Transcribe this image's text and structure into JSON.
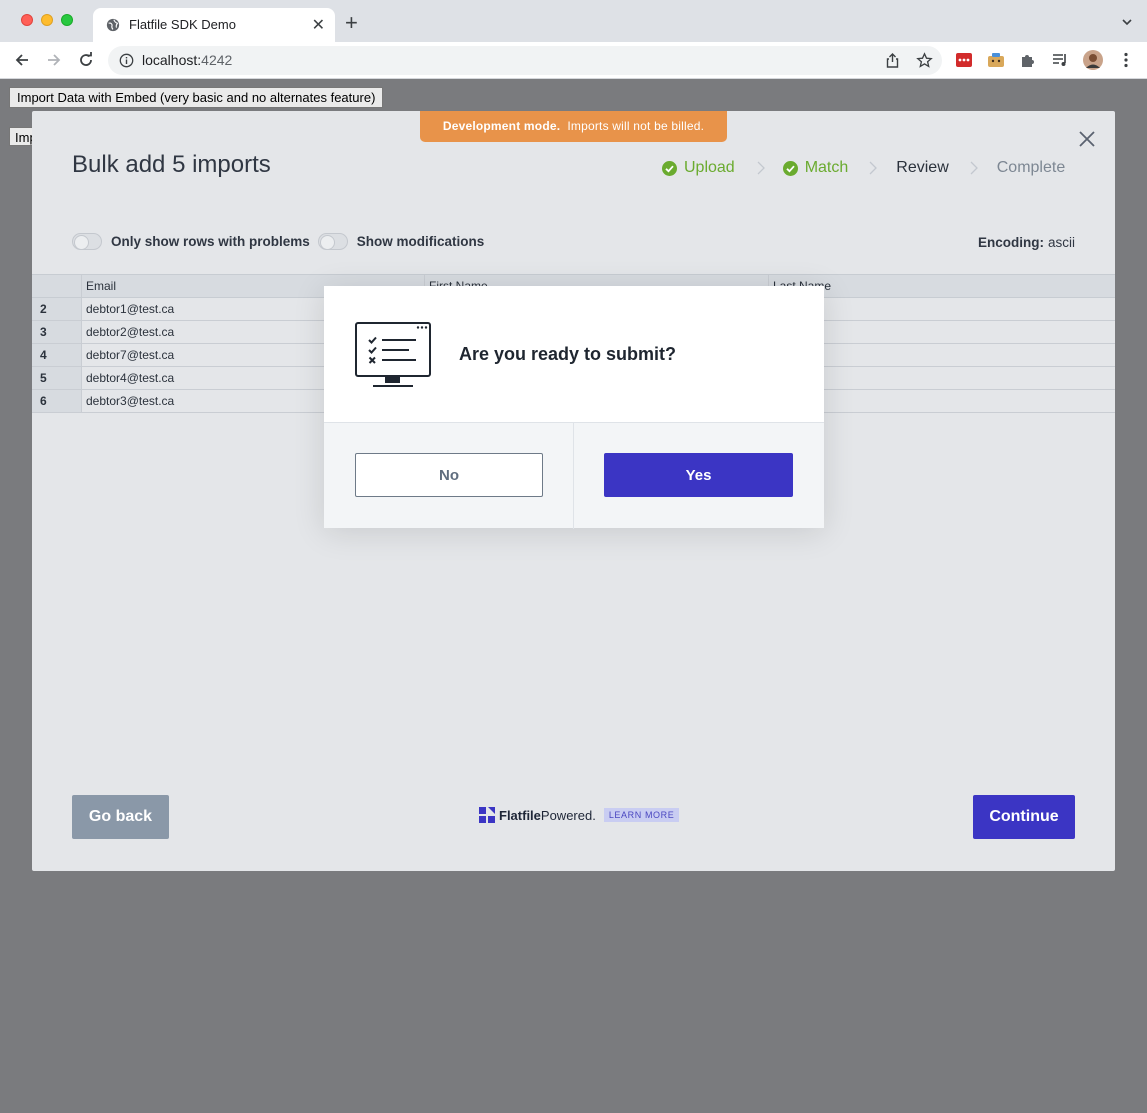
{
  "browser": {
    "tab_title": "Flatfile SDK Demo",
    "url_host": "localhost:",
    "url_port": "4242"
  },
  "page": {
    "embed_button": "Import Data with Embed (very basic and no alternates feature)",
    "import_button_partial": "Imp"
  },
  "flatfile": {
    "dev_banner_bold": "Development mode.",
    "dev_banner_text": "Imports will not be billed.",
    "title": "Bulk add 5 imports",
    "steps": [
      {
        "label": "Upload",
        "state": "done"
      },
      {
        "label": "Match",
        "state": "done"
      },
      {
        "label": "Review",
        "state": "current"
      },
      {
        "label": "Complete",
        "state": "future"
      }
    ],
    "toggles": {
      "problems_label": "Only show rows with problems",
      "modifications_label": "Show modifications"
    },
    "encoding_label": "Encoding:",
    "encoding_value": "ascii",
    "grid": {
      "columns": [
        "Email",
        "First Name",
        "Last Name"
      ],
      "rows": [
        {
          "index": "2",
          "email": "debtor1@test.ca"
        },
        {
          "index": "3",
          "email": "debtor2@test.ca"
        },
        {
          "index": "4",
          "email": "debtor7@test.ca"
        },
        {
          "index": "5",
          "email": "debtor4@test.ca"
        },
        {
          "index": "6",
          "email": "debtor3@test.ca"
        }
      ]
    },
    "go_back_label": "Go back",
    "continue_label": "Continue",
    "powered_brand": "Flatfile",
    "powered_word": "Powered.",
    "learn_more": "LEARN MORE"
  },
  "dialog": {
    "question": "Are you ready to submit?",
    "no_label": "No",
    "yes_label": "Yes"
  },
  "colors": {
    "accent": "#3b35c4",
    "success": "#6aab2f",
    "banner": "#e8934a",
    "overlay": "#7a7b7e"
  }
}
